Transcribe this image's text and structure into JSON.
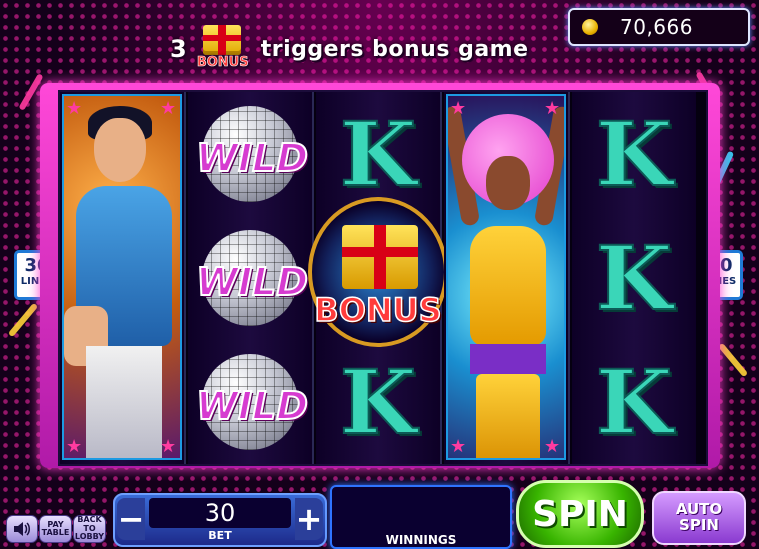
{
  "banner": {
    "count": "3",
    "bonus_label": "BONUS",
    "message": "triggers bonus game"
  },
  "balance": {
    "amount": "70,666",
    "icon": "coin-icon"
  },
  "lines": {
    "count": "30",
    "label": "LINES"
  },
  "reels": [
    {
      "symbol": "man-character"
    },
    {
      "symbols": [
        "WILD",
        "WILD",
        "WILD"
      ]
    },
    {
      "symbols": [
        "K",
        "BONUS",
        "K"
      ]
    },
    {
      "symbol": "woman-character"
    },
    {
      "symbols": [
        "K",
        "K",
        "K"
      ]
    }
  ],
  "symbols": {
    "wild_text": "WILD",
    "k_text": "K",
    "bonus_text": "BONUS"
  },
  "controls": {
    "sound_icon": "speaker-icon",
    "paytable_label": "PAY TABLE",
    "back_label": "BACK TO LOBBY",
    "bet_minus": "−",
    "bet_value": "30",
    "bet_plus": "+",
    "bet_label": "BET",
    "winnings_label": "WINNINGS",
    "spin_label": "SPIN",
    "autospin_label": "AUTO SPIN"
  },
  "colors": {
    "frame": "#ff48d8",
    "spin_button": "#38b400",
    "autospin_button": "#8a3ad0",
    "bet_panel": "#1d2a8a"
  }
}
